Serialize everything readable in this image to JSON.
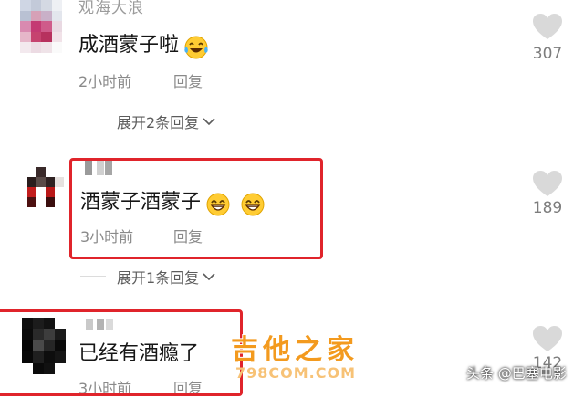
{
  "comments": [
    {
      "username": "观海大浪",
      "text": "成酒蒙子啦",
      "emoji": "laughing-tears-emoji",
      "time": "2小时前",
      "reply_label": "回复",
      "likes": "307",
      "expand_label": "展开2条回复"
    },
    {
      "username": "",
      "text": "酒蒙子酒蒙子",
      "emoji": "grin-emoji",
      "time": "3小时前",
      "reply_label": "回复",
      "likes": "189",
      "expand_label": "展开1条回复"
    },
    {
      "username": "",
      "text": "已经有酒瘾了",
      "time": "3小时前",
      "reply_label": "回复",
      "likes": "142"
    }
  ],
  "watermark": {
    "title": "吉他之家",
    "url": "798COM.COM"
  },
  "credit": "头条 @巴塞电影",
  "colors": {
    "highlight": "#e0242b",
    "watermark": "#f39a1e"
  }
}
